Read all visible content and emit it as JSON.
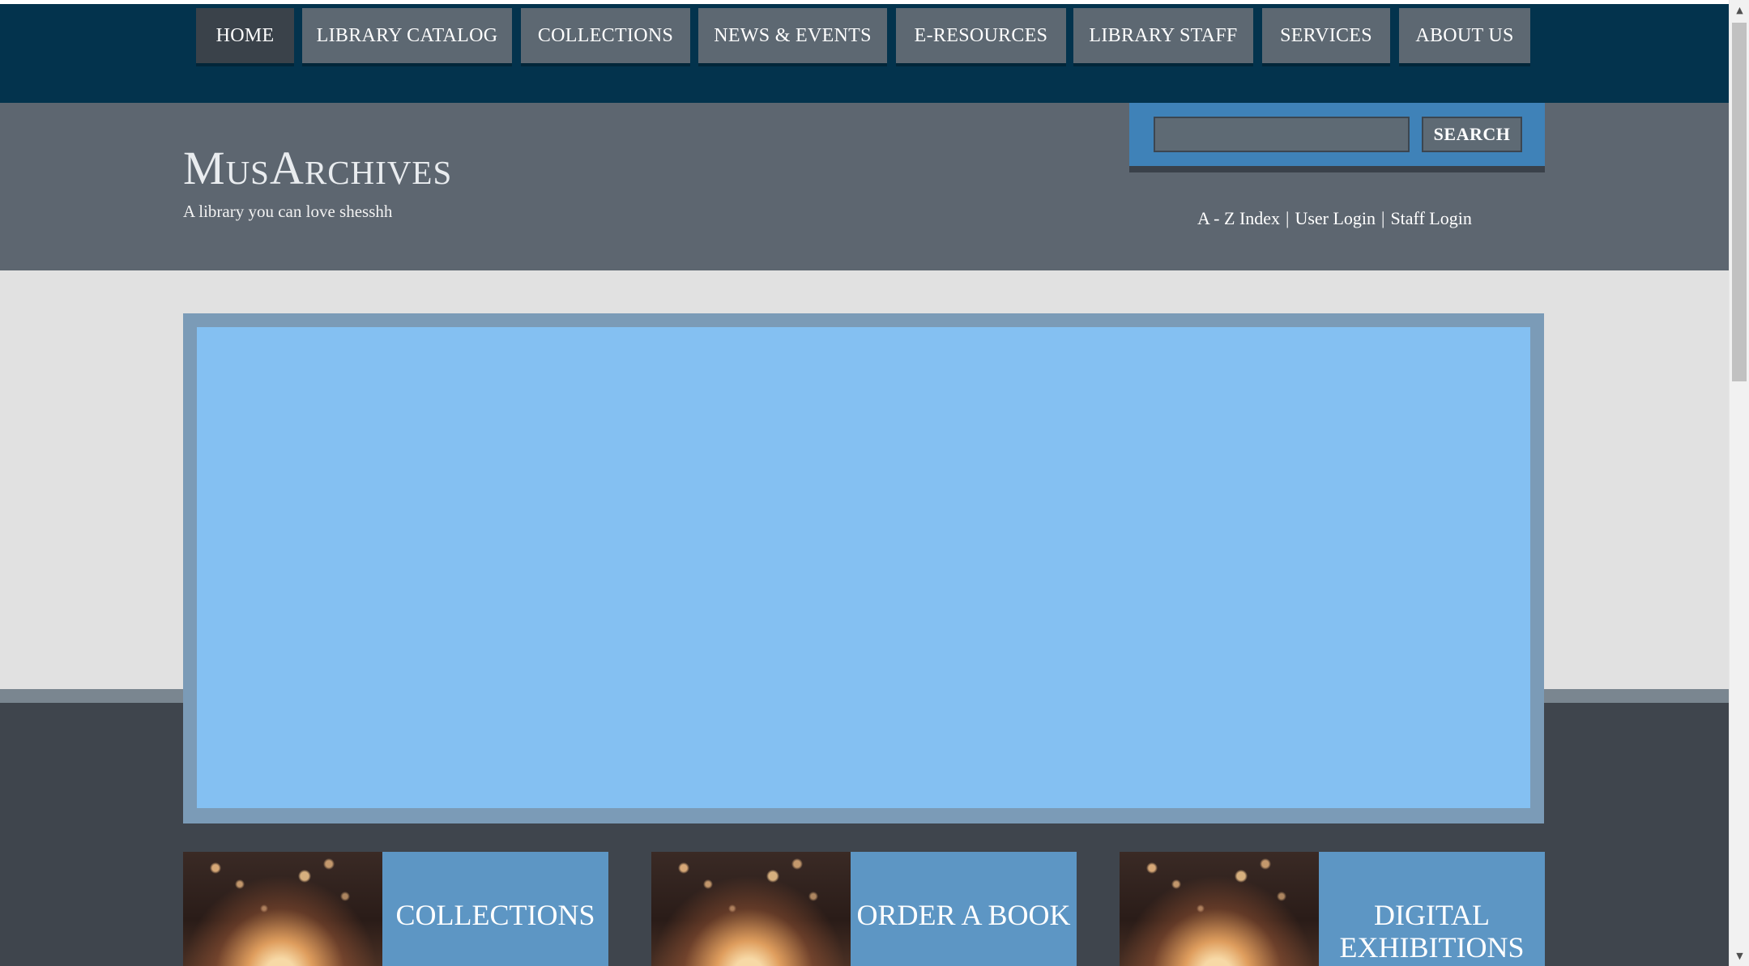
{
  "nav": {
    "items": [
      {
        "label": "HOME",
        "active": true
      },
      {
        "label": "LIBRARY CATALOG"
      },
      {
        "label": "COLLECTIONS"
      },
      {
        "label": "NEWS & EVENTS"
      },
      {
        "label": "E-RESOURCES"
      },
      {
        "label": "LIBRARY STAFF"
      },
      {
        "label": "SERVICES"
      },
      {
        "label": "ABOUT US"
      }
    ]
  },
  "header": {
    "site_title": "MusArchives",
    "tagline": "A library you can love shesshh",
    "search": {
      "value": "",
      "button_label": "SEARCH"
    },
    "links": {
      "az_index": "A - Z Index",
      "user_login": "User Login",
      "staff_login": "Staff Login",
      "separator": "|"
    }
  },
  "tiles": [
    {
      "label": "COLLECTIONS",
      "icon": "open-book-sparkles-image"
    },
    {
      "label": "ORDER A BOOK",
      "icon": "open-book-sparkles-image"
    },
    {
      "label": "DIGITAL EXHIBITIONS",
      "icon": "open-book-sparkles-image"
    }
  ],
  "colors": {
    "nav_bg": "#03334d",
    "nav_item": "#5d6872",
    "nav_active": "#3a424a",
    "header_bg": "#5d6670",
    "search_panel": "#3f82b8",
    "slider": "#84c0f2",
    "tile": "#5d96c4",
    "band": "#3f454d"
  }
}
